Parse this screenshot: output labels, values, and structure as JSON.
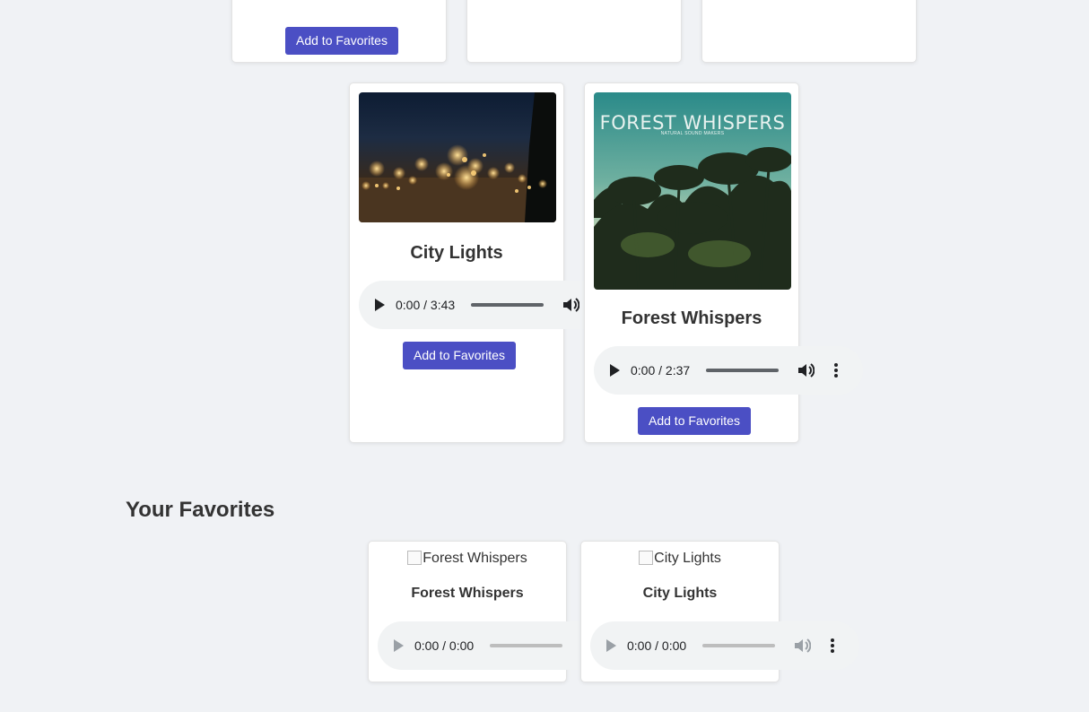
{
  "tracks": [
    {
      "title": "City Lights",
      "time": "0:00 / 3:43",
      "button": "Add to Favorites"
    },
    {
      "title": "Forest Whispers",
      "time": "0:00 / 2:37",
      "button": "Add to Favorites",
      "cover_text": "FOREST WHISPERS",
      "cover_subtext": "NATURAL SOUND MAKERS"
    }
  ],
  "top_card_button": "Add to Favorites",
  "favorites": {
    "heading": "Your Favorites",
    "items": [
      {
        "title": "Forest Whispers",
        "alt": "Forest Whispers",
        "time": "0:00 / 0:00"
      },
      {
        "title": "City Lights",
        "alt": "City Lights",
        "time": "0:00 / 0:00"
      }
    ]
  },
  "colors": {
    "accent": "#4b4fc4",
    "page_bg": "#f0f2f5",
    "card_bg": "#ffffff"
  }
}
